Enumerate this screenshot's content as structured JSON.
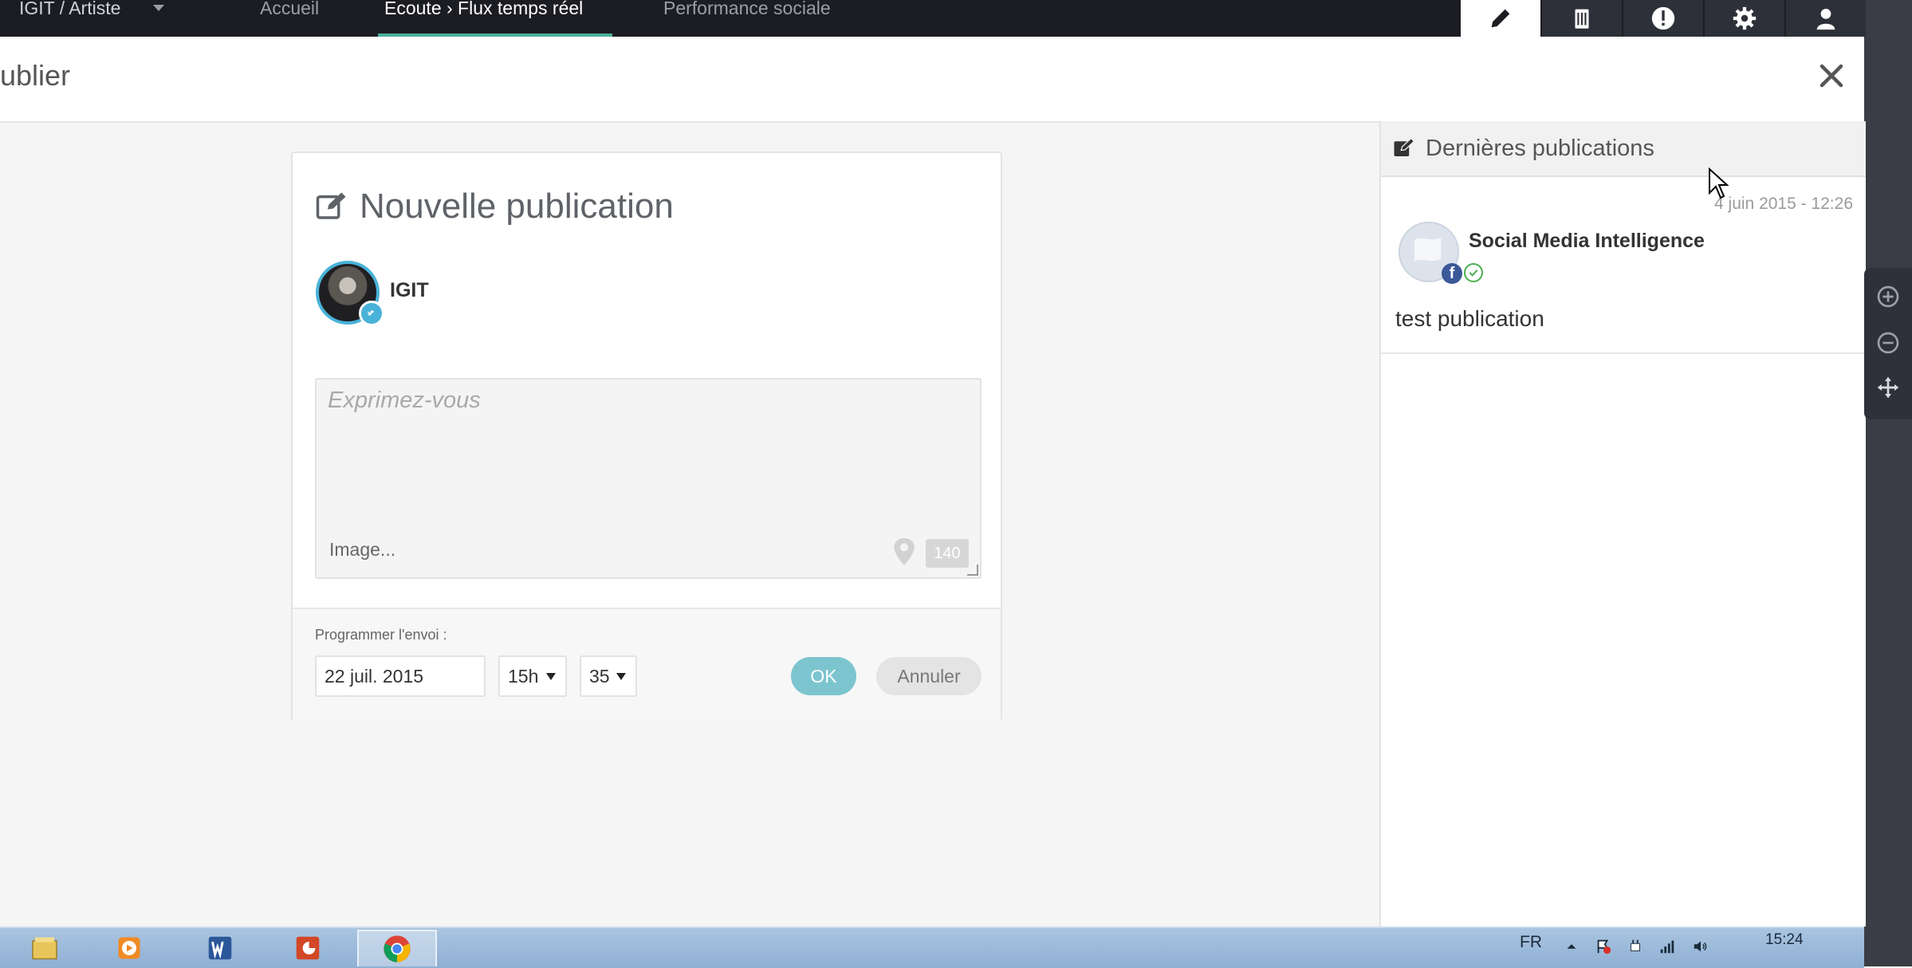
{
  "topnav": {
    "account_label": "IGIT / Artiste",
    "items": [
      {
        "label": "Accueil"
      },
      {
        "label": "Ecoute › Flux temps réel"
      },
      {
        "label": "Performance sociale"
      }
    ],
    "icons": [
      "pencil-icon",
      "clipboard-icon",
      "alert-icon",
      "gear-icon",
      "user-icon"
    ]
  },
  "header": {
    "title": "ublier"
  },
  "composer": {
    "title": "Nouvelle publication",
    "account_name": "IGIT",
    "account_network": "twitter",
    "message_placeholder": "Exprimez-vous",
    "image_label": "Image...",
    "char_count": "140",
    "schedule_label": "Programmer l'envoi :",
    "date_value": "22 juil. 2015",
    "hour_value": "15h",
    "minute_value": "35",
    "ok_label": "OK",
    "cancel_label": "Annuler"
  },
  "recent": {
    "title": "Dernières publications",
    "items": [
      {
        "date": "4 juin 2015 - 12:26",
        "page_name": "Social Media Intelligence",
        "network": "facebook",
        "text": "test publication"
      }
    ]
  },
  "taskbar": {
    "apps": [
      "file-explorer-icon",
      "media-player-icon",
      "word-icon",
      "powerpoint-icon",
      "chrome-icon"
    ],
    "language": "FR",
    "time": "15:24"
  },
  "colors": {
    "topbar_bg": "#1c1d22",
    "accent": "#4caf9a",
    "twitter": "#49b2d8",
    "facebook": "#3b5998",
    "ok_button": "#7cc5cf"
  }
}
